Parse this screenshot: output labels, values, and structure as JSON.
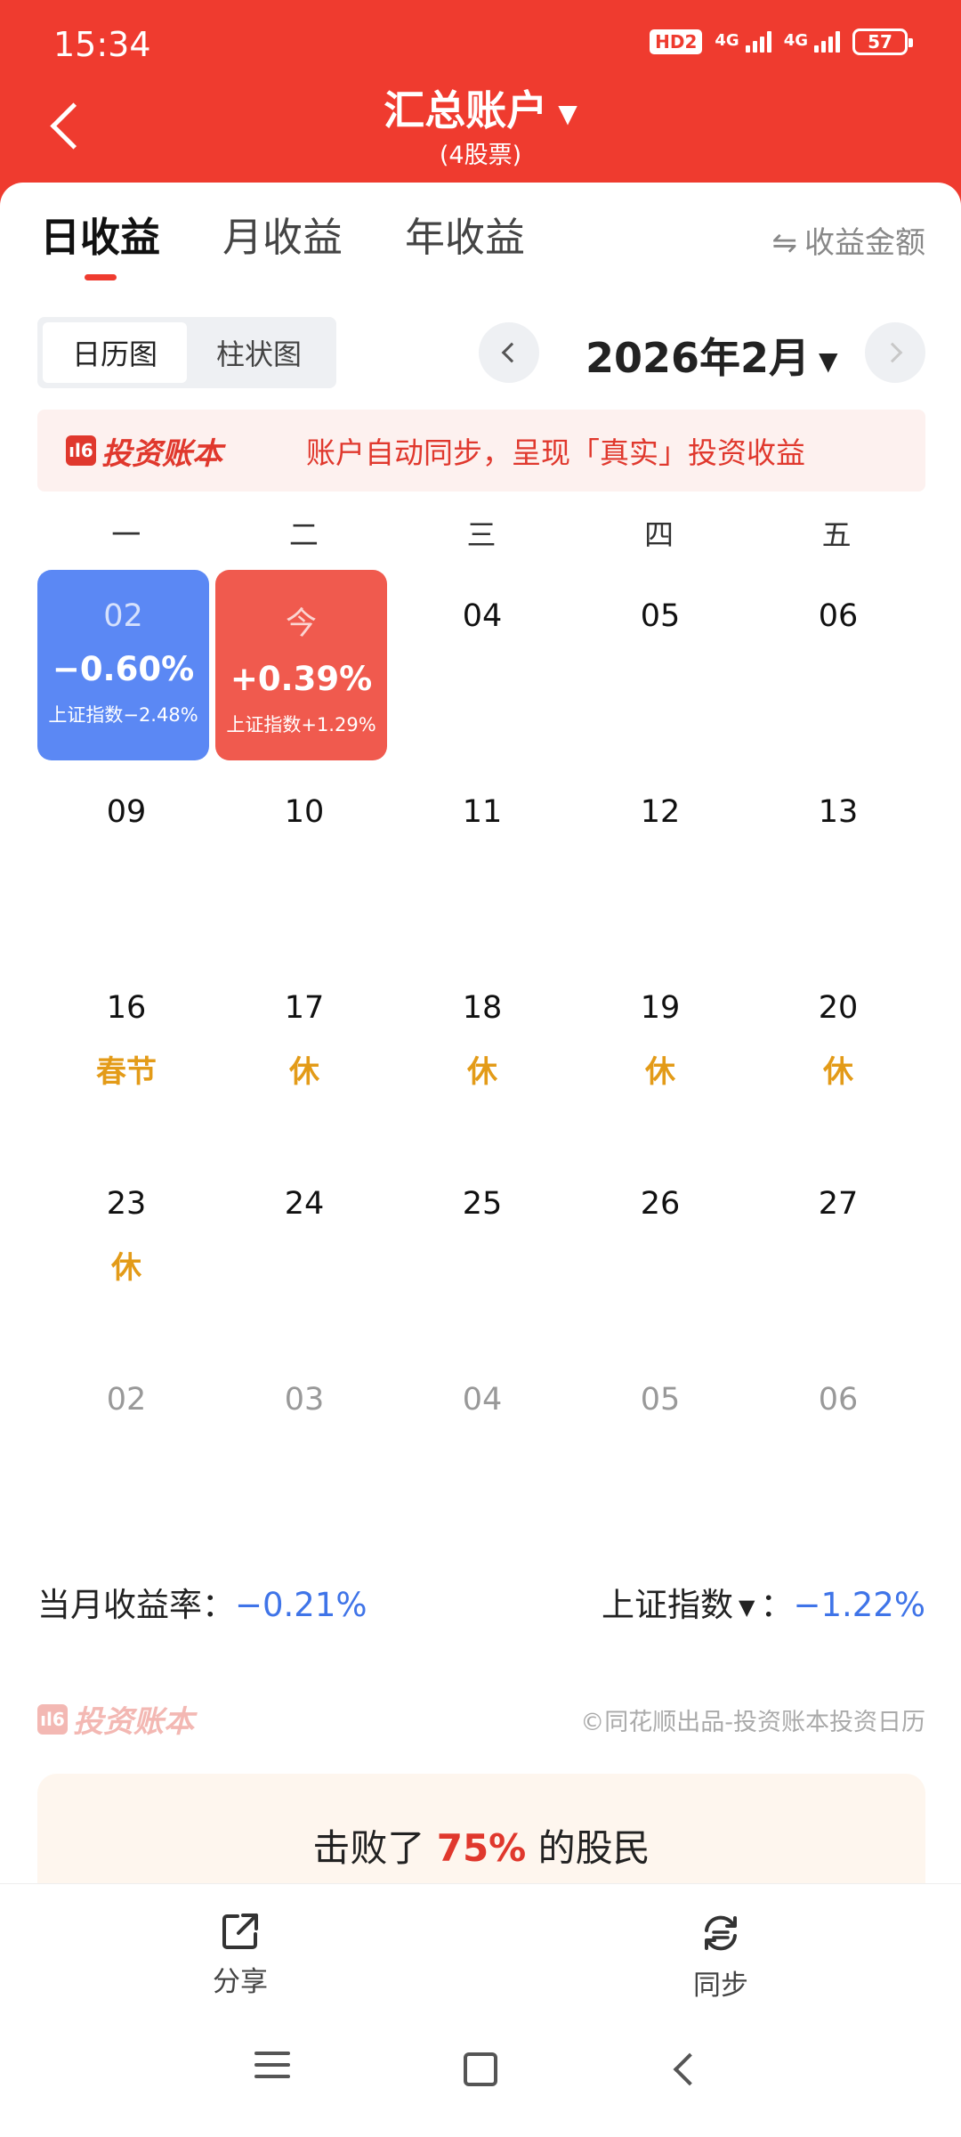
{
  "status": {
    "time": "15:34",
    "hd": "HD2",
    "network": [
      "4G",
      "4G"
    ],
    "battery": "57"
  },
  "nav": {
    "title": "汇总账户",
    "subtitle": "(4股票)"
  },
  "tabs": [
    {
      "label": "日收益",
      "active": true
    },
    {
      "label": "月收益",
      "active": false
    },
    {
      "label": "年收益",
      "active": false
    }
  ],
  "amount_toggle": {
    "icon": "⇋",
    "label": "收益金额"
  },
  "view_toggle": [
    {
      "label": "日历图",
      "active": true
    },
    {
      "label": "柱状图",
      "active": false
    }
  ],
  "month": {
    "label": "2026年2月"
  },
  "banner": {
    "brand": "投资账本",
    "logo": "ıl6",
    "text": "账户自动同步，呈现「真实」投资收益"
  },
  "weekdays": [
    "一",
    "二",
    "三",
    "四",
    "五"
  ],
  "calendar": [
    [
      {
        "day": "02",
        "pct": "−0.60%",
        "index": "上证指数−2.48%",
        "tile": "blue"
      },
      {
        "day": "今",
        "pct": "+0.39%",
        "index": "上证指数+1.29%",
        "tile": "red"
      },
      {
        "day": "04"
      },
      {
        "day": "05"
      },
      {
        "day": "06"
      }
    ],
    [
      {
        "day": "09"
      },
      {
        "day": "10"
      },
      {
        "day": "11"
      },
      {
        "day": "12"
      },
      {
        "day": "13"
      }
    ],
    [
      {
        "day": "16",
        "tag": "春节"
      },
      {
        "day": "17",
        "tag": "休"
      },
      {
        "day": "18",
        "tag": "休"
      },
      {
        "day": "19",
        "tag": "休"
      },
      {
        "day": "20",
        "tag": "休"
      }
    ],
    [
      {
        "day": "23",
        "tag": "休"
      },
      {
        "day": "24"
      },
      {
        "day": "25"
      },
      {
        "day": "26"
      },
      {
        "day": "27"
      }
    ],
    [
      {
        "day": "02",
        "muted": true
      },
      {
        "day": "03",
        "muted": true
      },
      {
        "day": "04",
        "muted": true
      },
      {
        "day": "05",
        "muted": true
      },
      {
        "day": "06",
        "muted": true
      }
    ]
  ],
  "summary": {
    "month_label": "当月收益率：",
    "month_value": "−0.21%",
    "index_label": "上证指数",
    "index_sep": "：",
    "index_value": "−1.22%"
  },
  "footer": {
    "brand": "投资账本",
    "copyright": "©同花顺出品-投资账本投资日历"
  },
  "beat": {
    "prefix": "击败了 ",
    "value": "75%",
    "suffix": " 的股民"
  },
  "actions": {
    "share": "分享",
    "sync": "同步"
  },
  "colors": {
    "header_red": "#ef3b2f",
    "loss_blue": "#5b88f4",
    "gain_red": "#f05a4e",
    "holiday_orange": "#e39b18",
    "value_blue": "#3f74e8"
  }
}
